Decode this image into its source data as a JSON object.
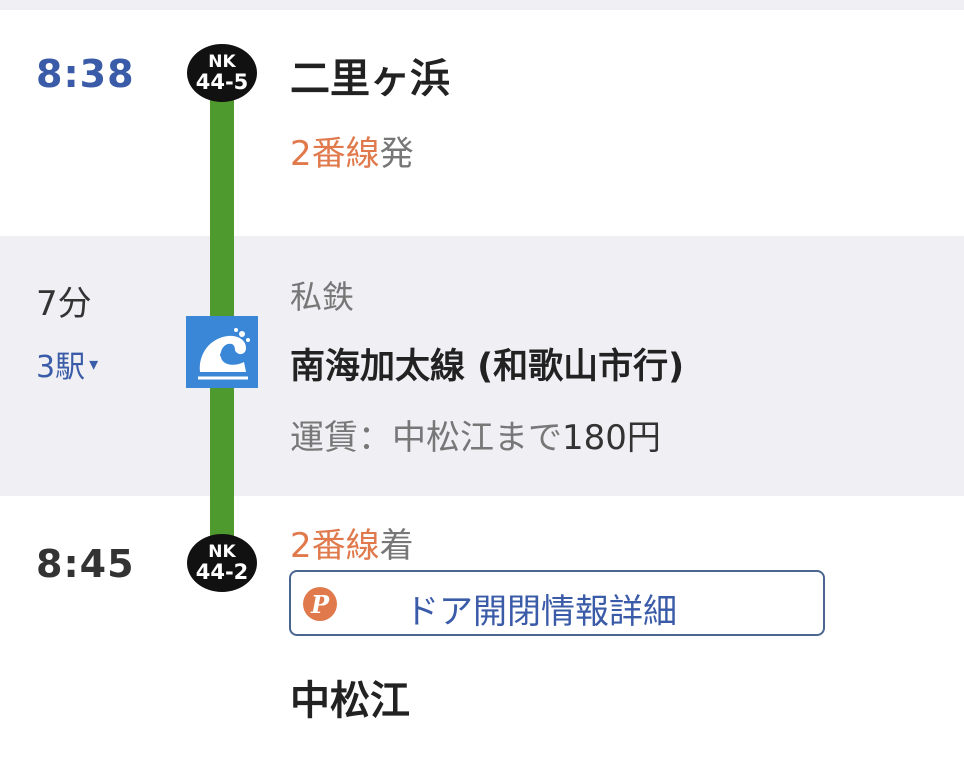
{
  "departure": {
    "time": "8:38",
    "station": "二里ヶ浜",
    "station_code": {
      "line": "NK",
      "number": "44-5"
    },
    "platform": "2番線",
    "platform_action": "発"
  },
  "segment": {
    "duration": "7分",
    "stops": "3駅",
    "stops_caret": "▾",
    "rail_type": "私鉄",
    "line": "南海加太線 (和歌山市行)",
    "fare_label": "運賃：中松江まで",
    "fare_amount": "180円",
    "operator_icon": "wave-icon",
    "line_color": "#4f9a2e",
    "logo_color": "#3a87d8"
  },
  "arrival": {
    "time": "8:45",
    "station": "中松江",
    "station_code": {
      "line": "NK",
      "number": "44-2"
    },
    "platform": "2番線",
    "platform_action": "着",
    "door_info_icon": "P",
    "door_info_label": "ドア開閉情報詳細"
  },
  "colors": {
    "time_accent": "#3a5ba8",
    "platform_accent": "#e07a4c",
    "band": "#efeff4"
  }
}
